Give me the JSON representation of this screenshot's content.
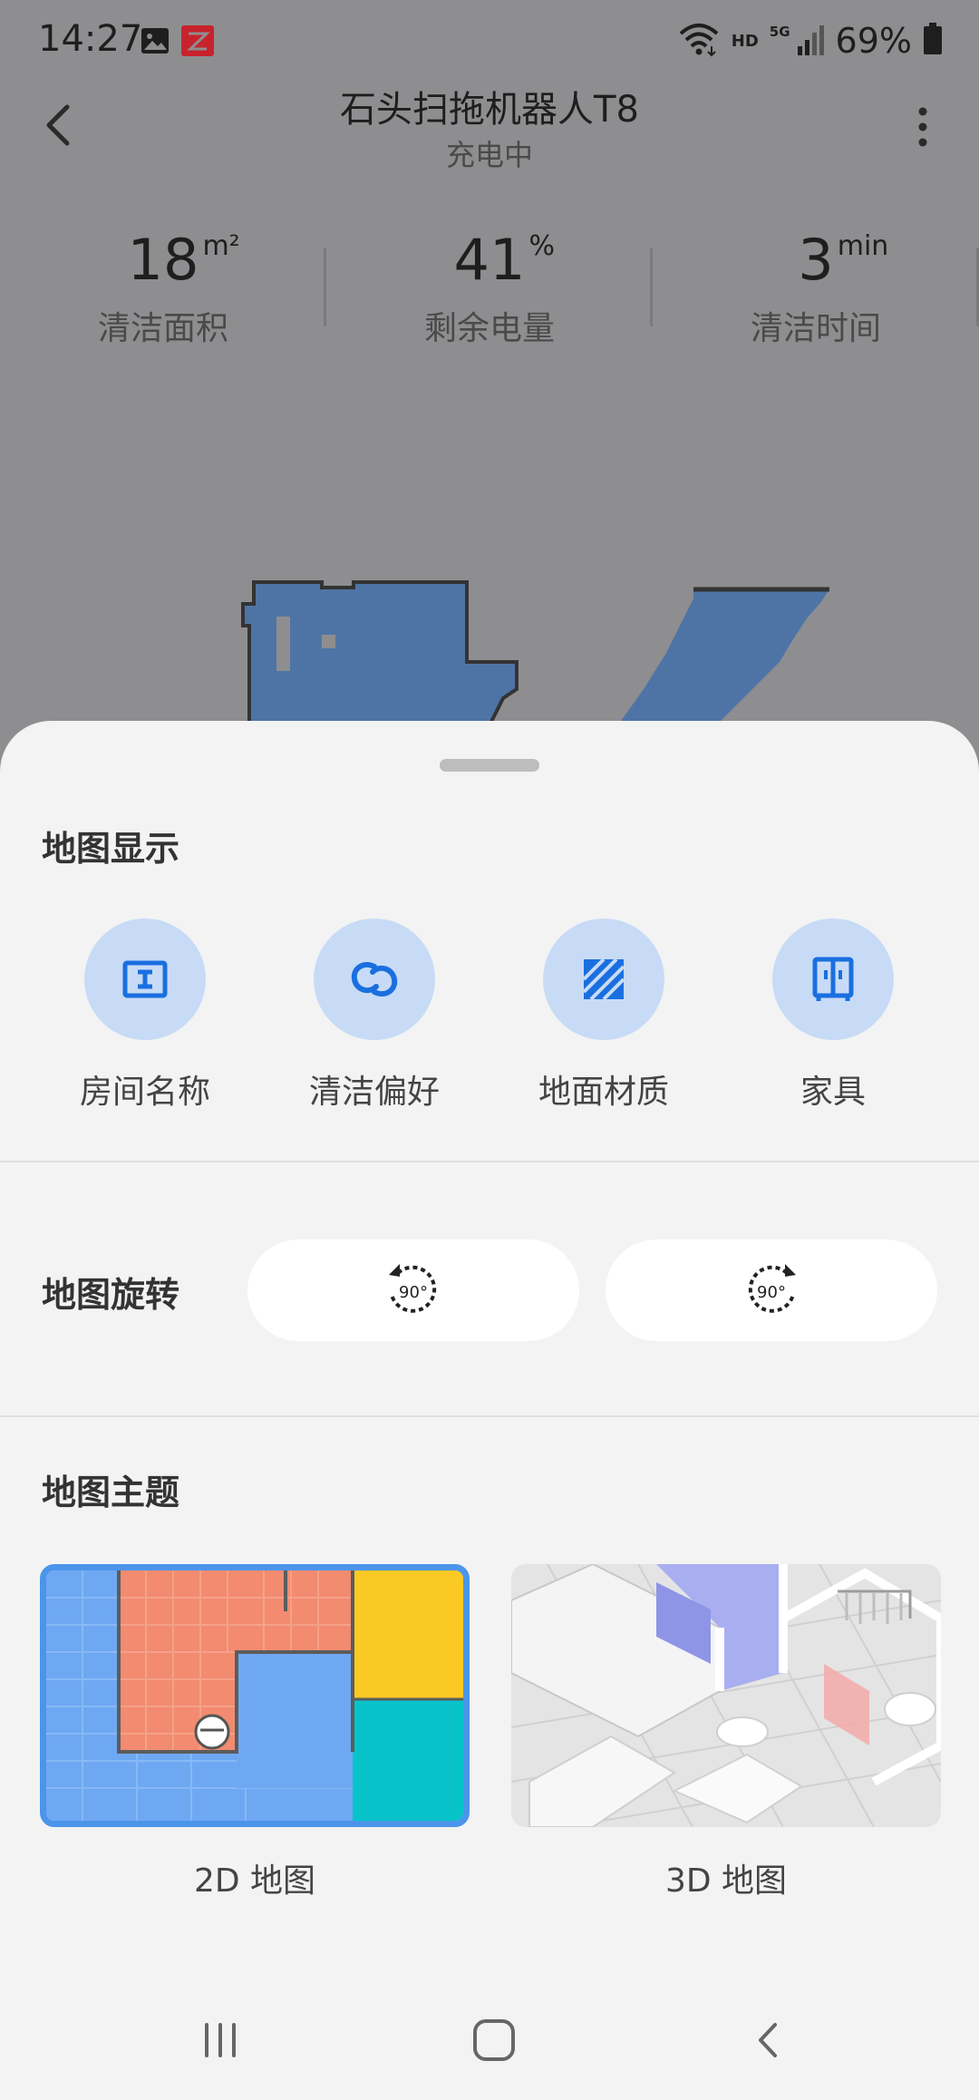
{
  "status_bar": {
    "time": "14:27",
    "network_hd": "HD",
    "network_5g": "5G",
    "battery_percent": "69%"
  },
  "header": {
    "title": "石头扫拖机器人T8",
    "subtitle": "充电中"
  },
  "stats": [
    {
      "value": "18",
      "unit": "m²",
      "label": "清洁面积"
    },
    {
      "value": "41",
      "unit": "%",
      "label": "剩余电量"
    },
    {
      "value": "3",
      "unit": "min",
      "label": "清洁时间"
    }
  ],
  "sheet": {
    "map_display": {
      "title": "地图显示",
      "options": [
        {
          "label": "房间名称",
          "icon": "room-name-icon"
        },
        {
          "label": "清洁偏好",
          "icon": "clean-preference-icon"
        },
        {
          "label": "地面材质",
          "icon": "floor-material-icon"
        },
        {
          "label": "家具",
          "icon": "furniture-icon"
        }
      ]
    },
    "map_rotate": {
      "title": "地图旋转",
      "counterclockwise_label": "90°",
      "clockwise_label": "90°"
    },
    "map_theme": {
      "title": "地图主题",
      "options": [
        {
          "label": "2D 地图",
          "selected": true
        },
        {
          "label": "3D 地图",
          "selected": false
        }
      ]
    }
  },
  "colors": {
    "accent": "#4b95ea",
    "icon_blue": "#1a6fe0",
    "icon_circle": "#c7dbf6",
    "sheet_bg": "#f3f3f3",
    "overlay_bg": "#8e8e90"
  }
}
